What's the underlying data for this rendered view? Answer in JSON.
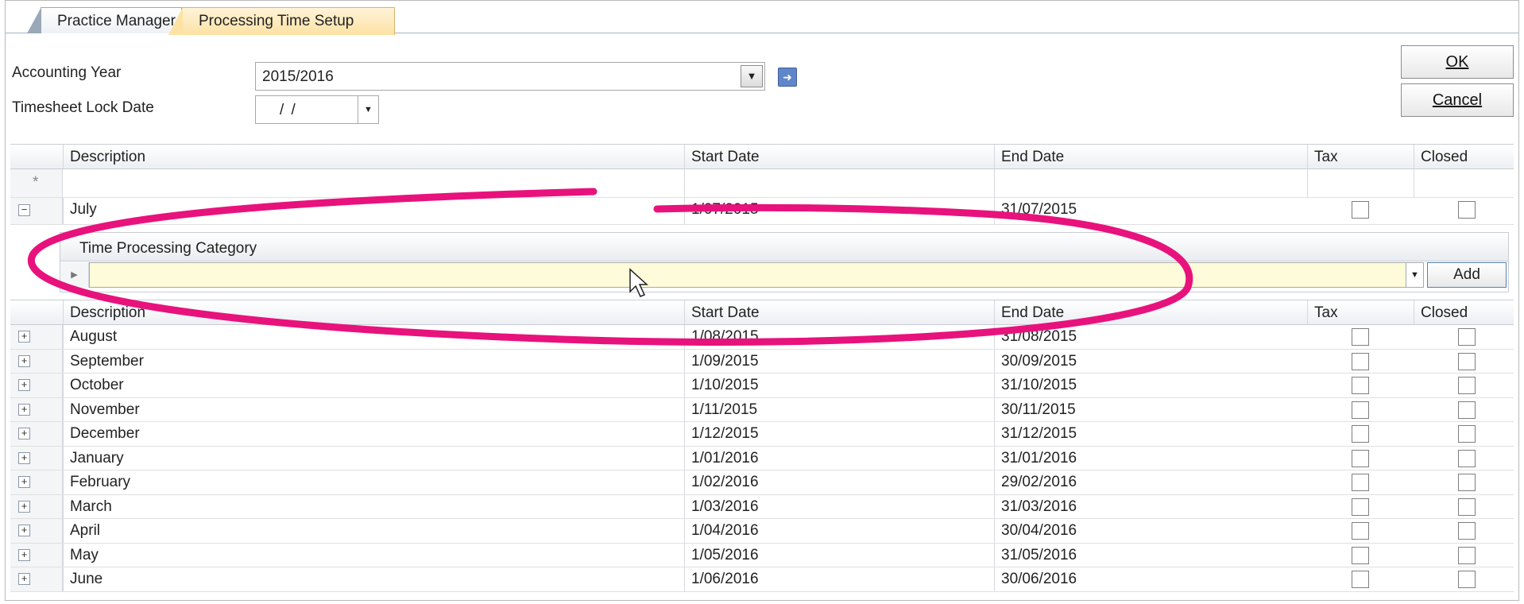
{
  "tabs": [
    {
      "label": "Practice Manager",
      "active": false
    },
    {
      "label": "Processing Time Setup",
      "active": true
    }
  ],
  "form": {
    "accounting_year_label": "Accounting Year",
    "accounting_year_value": "2015/2016",
    "lock_date_label": "Timesheet Lock Date",
    "lock_date_value": "/ /"
  },
  "buttons": {
    "ok": "OK",
    "cancel": "Cancel",
    "add": "Add"
  },
  "columns": {
    "description": "Description",
    "start": "Start Date",
    "end": "End Date",
    "tax": "Tax",
    "closed": "Closed"
  },
  "new_row_marker": "*",
  "expanded_row": {
    "description": "July",
    "start": "1/07/2015",
    "end": "31/07/2015",
    "tax": false,
    "closed": false
  },
  "sub_grid": {
    "header": "Time Processing Category",
    "value": ""
  },
  "periods": [
    {
      "description": "August",
      "start": "1/08/2015",
      "end": "31/08/2015",
      "tax": false,
      "closed": false
    },
    {
      "description": "September",
      "start": "1/09/2015",
      "end": "30/09/2015",
      "tax": false,
      "closed": false
    },
    {
      "description": "October",
      "start": "1/10/2015",
      "end": "31/10/2015",
      "tax": false,
      "closed": false
    },
    {
      "description": "November",
      "start": "1/11/2015",
      "end": "30/11/2015",
      "tax": false,
      "closed": false
    },
    {
      "description": "December",
      "start": "1/12/2015",
      "end": "31/12/2015",
      "tax": false,
      "closed": false
    },
    {
      "description": "January",
      "start": "1/01/2016",
      "end": "31/01/2016",
      "tax": false,
      "closed": false
    },
    {
      "description": "February",
      "start": "1/02/2016",
      "end": "29/02/2016",
      "tax": false,
      "closed": false
    },
    {
      "description": "March",
      "start": "1/03/2016",
      "end": "31/03/2016",
      "tax": false,
      "closed": false
    },
    {
      "description": "April",
      "start": "1/04/2016",
      "end": "30/04/2016",
      "tax": false,
      "closed": false
    },
    {
      "description": "May",
      "start": "1/05/2016",
      "end": "31/05/2016",
      "tax": false,
      "closed": false
    },
    {
      "description": "June",
      "start": "1/06/2016",
      "end": "30/06/2016",
      "tax": false,
      "closed": false
    }
  ],
  "colors": {
    "annotation": "#e8127c",
    "tab_active": "#fde2a4",
    "edit_row": "#fdfbd9"
  },
  "icons": {
    "expand": "expand-plus-icon",
    "collapse": "collapse-minus-icon",
    "exit": "exit-icon",
    "dropdown": "chevron-down-icon"
  }
}
